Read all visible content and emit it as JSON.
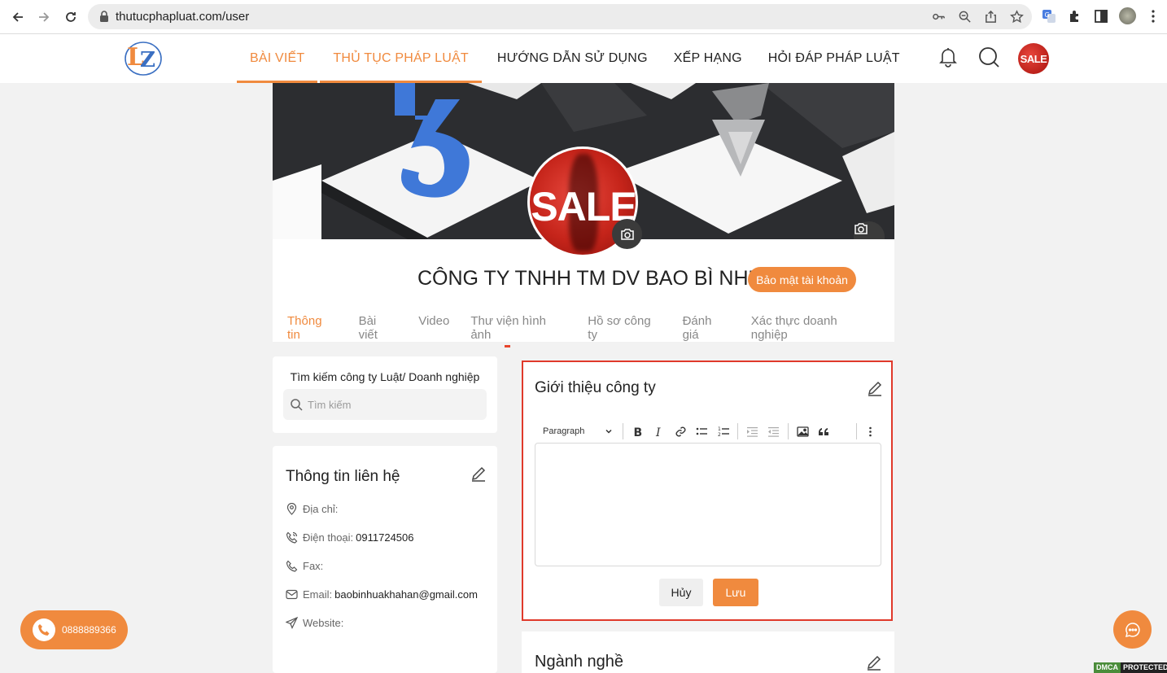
{
  "browser": {
    "url": "thutucphapluat.com/user"
  },
  "header": {
    "nav": [
      {
        "label": "BÀI VIẾT",
        "active": true
      },
      {
        "label": "THỦ TỤC PHÁP LUẬT",
        "active": true
      },
      {
        "label": "HƯỚNG DẪN SỬ DỤNG",
        "active": false
      },
      {
        "label": "XẾP HẠNG",
        "active": false
      },
      {
        "label": "HỎI ĐÁP PHÁP LUẬT",
        "active": false
      }
    ],
    "avatar_text": "SALE"
  },
  "profile": {
    "avatar_text": "SALE",
    "company_name": "CÔNG TY TNHH TM DV BAO BÌ NHỰA KHẢ HÂN",
    "security_button": "Bảo mật tài khoản",
    "tabs": [
      {
        "label": "Thông tin",
        "active": true
      },
      {
        "label": "Bài viết",
        "active": false
      },
      {
        "label": "Video",
        "active": false
      },
      {
        "label": "Thư viện hình ảnh",
        "active": false
      },
      {
        "label": "Hồ sơ công ty",
        "active": false
      },
      {
        "label": "Đánh giá",
        "active": false
      },
      {
        "label": "Xác thực doanh nghiệp",
        "active": false
      }
    ]
  },
  "search": {
    "title": "Tìm kiếm công ty Luật/ Doanh nghiệp",
    "placeholder": "Tìm kiếm"
  },
  "contact": {
    "title": "Thông tin liên hệ",
    "address_label": "Địa chỉ:",
    "phone_label": "Điện thoại:",
    "phone_value": "0911724506",
    "fax_label": "Fax:",
    "email_label": "Email:",
    "email_value": "baobinhuakhahan@gmail.com",
    "website_label": "Website:"
  },
  "intro": {
    "title": "Giới thiệu công ty",
    "format_select": "Paragraph",
    "cancel_label": "Hủy",
    "save_label": "Lưu"
  },
  "industry": {
    "title": "Ngành nghề"
  },
  "floating": {
    "hotline": "0888889366",
    "dmca_left": "DMCA",
    "dmca_right": "PROTECTED"
  },
  "colors": {
    "accent": "#f08a3e",
    "highlight_border": "#e0392b"
  }
}
